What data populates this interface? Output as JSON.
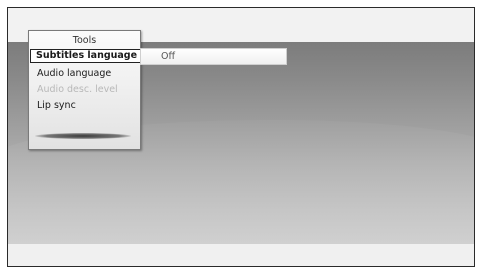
{
  "menu": {
    "title": "Tools",
    "items": [
      {
        "label": "Subtitles language",
        "state": "selected"
      },
      {
        "label": "Audio language",
        "state": "normal"
      },
      {
        "label": "Audio desc. level",
        "state": "disabled"
      },
      {
        "label": "Lip sync",
        "state": "normal"
      }
    ]
  },
  "value_field": {
    "value": "Off"
  },
  "colors": {
    "menu_border": "#7a7a7a",
    "selected_border": "#222222",
    "disabled_text": "#b8b8b8"
  }
}
